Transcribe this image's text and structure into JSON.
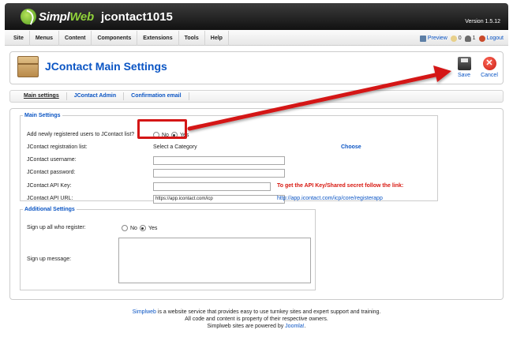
{
  "header": {
    "logo_prefix": "Simpl",
    "logo_suffix": "Web",
    "site_name": "jcontact1015",
    "version": "Version 1.5.12"
  },
  "menu": {
    "items": [
      "Site",
      "Menus",
      "Content",
      "Components",
      "Extensions",
      "Tools",
      "Help"
    ]
  },
  "status": {
    "preview": "Preview",
    "messages_count": "0",
    "users_count": "1",
    "logout": "Logout"
  },
  "toolbar": {
    "title": "JContact Main Settings",
    "save_label": "Save",
    "cancel_label": "Cancel",
    "cancel_glyph": "✕"
  },
  "tabs": [
    "Main settings",
    "JContact Admin",
    "Confirmation email"
  ],
  "main_settings": {
    "legend": "Main Settings",
    "add_users_label": "Add newly registered users to JContact list?",
    "no_label": "No",
    "yes_label": "Yes",
    "registration_list_label": "JContact registration list:",
    "registration_list_value": "Select a Category",
    "choose_label": "Choose",
    "username_label": "JContact username:",
    "username_value": "",
    "password_label": "JContact password:",
    "password_value": "",
    "api_key_label": "JContact API Key:",
    "api_key_value": "",
    "api_hint": "To get the API Key/Shared secret follow the link:",
    "api_url_label": "JContact API URL:",
    "api_url_value": "https://app.icontact.com/icp",
    "api_link": "http://app.icontact.com/icp/core/registerapp"
  },
  "additional_settings": {
    "legend": "Additional Settings",
    "signup_label": "Sign up all who register:",
    "no_label": "No",
    "yes_label": "Yes",
    "message_label": "Sign up message:",
    "message_value": ""
  },
  "footer": {
    "line1_link": "Simplweb",
    "line1_text": " is a website service that provides easy to use turnkey sites and expert support and training.",
    "line2": "All code and content is property of their respective owners.",
    "line3_text": "Simplweb sites are powered by ",
    "line3_link": "Joomla!",
    "line3_end": "."
  },
  "colors": {
    "link": "#0b55c4",
    "annotation": "#d41616",
    "header_bg": "#1e1e1e"
  }
}
